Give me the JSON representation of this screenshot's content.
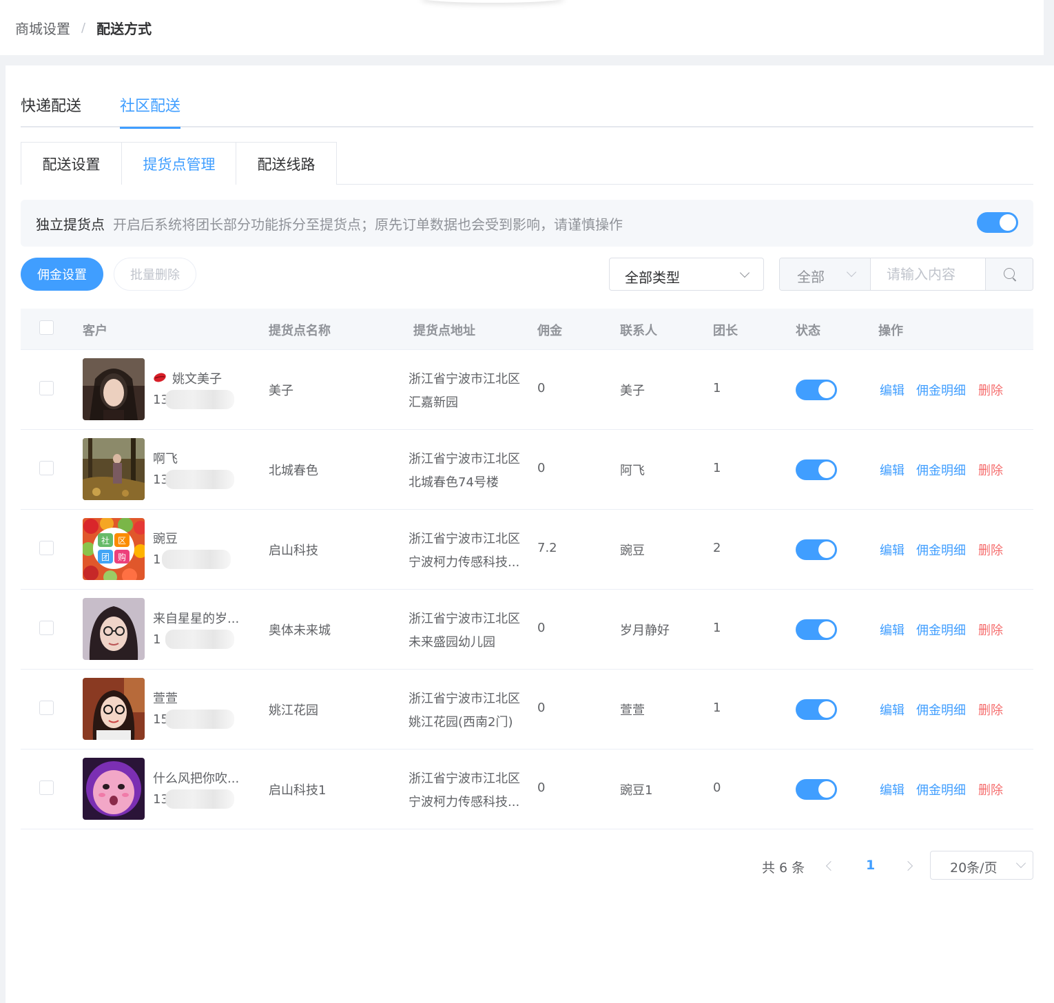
{
  "breadcrumb": {
    "parent": "商城设置",
    "separator": "/",
    "current": "配送方式"
  },
  "tabs": [
    "快递配送",
    "社区配送"
  ],
  "active_tab": "社区配送",
  "subtabs": [
    "配送设置",
    "提货点管理",
    "配送线路"
  ],
  "active_subtab": "提货点管理",
  "notice": {
    "title": "独立提货点",
    "description": "开启后系统将团长部分功能拆分至提货点；原先订单数据也会受到影响，请谨慎操作",
    "enabled": true
  },
  "toolbar": {
    "commission_settings": "佣金设置",
    "batch_delete": "批量删除"
  },
  "filters": {
    "type_select": "全部类型",
    "scope_select": "全部",
    "search_placeholder": "请输入内容"
  },
  "table": {
    "headers": {
      "customer": "客户",
      "point_name": "提货点名称",
      "point_address": "提货点地址",
      "commission": "佣金",
      "contact": "联系人",
      "leader": "团长",
      "status": "状态",
      "actions": "操作"
    },
    "action_labels": {
      "edit": "编辑",
      "commission_detail": "佣金明细",
      "delete": "删除"
    },
    "rows": [
      {
        "customer_name": "姚文美子",
        "phone_prefix": "13",
        "point_name": "美子",
        "address_line1": "浙江省宁波市江北区",
        "address_line2": "汇嘉新园",
        "commission": "0",
        "contact": "美子",
        "leader": "1",
        "status": true
      },
      {
        "customer_name": "啊飞",
        "phone_prefix": "13",
        "point_name": "北城春色",
        "address_line1": "浙江省宁波市江北区",
        "address_line2": "北城春色74号楼",
        "commission": "0",
        "contact": "阿飞",
        "leader": "1",
        "status": true
      },
      {
        "customer_name": "豌豆",
        "phone_prefix": "1",
        "point_name": "启山科技",
        "address_line1": "浙江省宁波市江北区",
        "address_line2": "宁波柯力传感科技...",
        "commission": "7.2",
        "contact": "豌豆",
        "leader": "2",
        "status": true
      },
      {
        "customer_name": "来自星星的岁...",
        "phone_prefix": "1",
        "point_name": "奥体未来城",
        "address_line1": "浙江省宁波市江北区",
        "address_line2": "未来盛园幼儿园",
        "commission": "0",
        "contact": "岁月静好",
        "leader": "1",
        "status": true
      },
      {
        "customer_name": "萱萱",
        "phone_prefix": "15",
        "point_name": "姚江花园",
        "address_line1": "浙江省宁波市江北区",
        "address_line2": "姚江花园(西南2门)",
        "commission": "0",
        "contact": "萱萱",
        "leader": "1",
        "status": true
      },
      {
        "customer_name": "什么风把你吹...",
        "phone_prefix": "13",
        "point_name": "启山科技1",
        "address_line1": "浙江省宁波市江北区",
        "address_line2": "宁波柯力传感科技...",
        "commission": "0",
        "contact": "豌豆1",
        "leader": "0",
        "status": true
      }
    ]
  },
  "pagination": {
    "total_text": "共 6 条",
    "current_page": "1",
    "page_size": "20条/页"
  },
  "colors": {
    "primary": "#409eff",
    "danger": "#f56c6c"
  }
}
